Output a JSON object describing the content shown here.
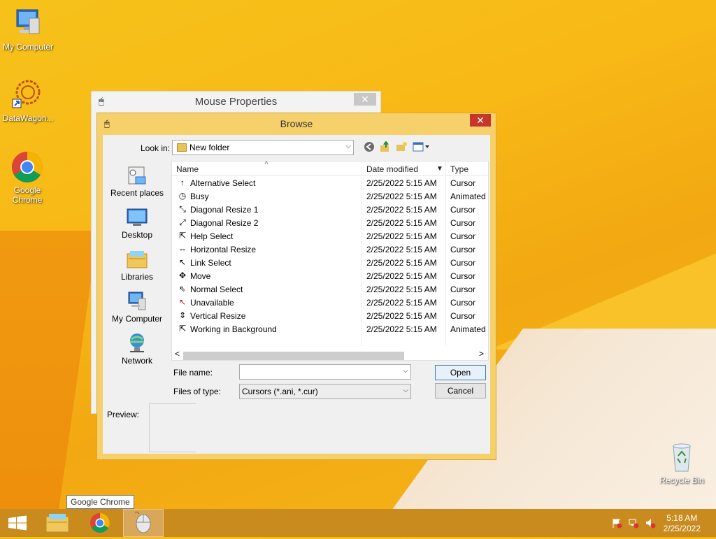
{
  "desktop": {
    "icons": [
      {
        "label": "My Computer"
      },
      {
        "label": "DataWagon..."
      },
      {
        "label": "Google Chrome"
      },
      {
        "label": "Recycle Bin"
      }
    ]
  },
  "mouse_properties": {
    "title": "Mouse Properties",
    "close": "✕"
  },
  "browse": {
    "title": "Browse",
    "close": "✕",
    "look_in_label": "Look in:",
    "look_in_value": "New folder",
    "places": [
      {
        "label": "Recent places"
      },
      {
        "label": "Desktop"
      },
      {
        "label": "Libraries"
      },
      {
        "label": "My Computer"
      },
      {
        "label": "Network"
      }
    ],
    "columns": {
      "name": "Name",
      "date": "Date modified",
      "type": "Type"
    },
    "files": [
      {
        "name": "Alternative Select",
        "date": "2/25/2022 5:15 AM",
        "type": "Cursor",
        "icon": "↑"
      },
      {
        "name": "Busy",
        "date": "2/25/2022 5:15 AM",
        "type": "Animated",
        "icon": "◷"
      },
      {
        "name": "Diagonal Resize 1",
        "date": "2/25/2022 5:15 AM",
        "type": "Cursor",
        "icon": "⤡"
      },
      {
        "name": "Diagonal Resize 2",
        "date": "2/25/2022 5:15 AM",
        "type": "Cursor",
        "icon": "⤢"
      },
      {
        "name": "Help Select",
        "date": "2/25/2022 5:15 AM",
        "type": "Cursor",
        "icon": "⇱"
      },
      {
        "name": "Horizontal Resize",
        "date": "2/25/2022 5:15 AM",
        "type": "Cursor",
        "icon": "⇔"
      },
      {
        "name": "Link Select",
        "date": "2/25/2022 5:15 AM",
        "type": "Cursor",
        "icon": "↖"
      },
      {
        "name": "Move",
        "date": "2/25/2022 5:15 AM",
        "type": "Cursor",
        "icon": "✥"
      },
      {
        "name": "Normal Select",
        "date": "2/25/2022 5:15 AM",
        "type": "Cursor",
        "icon": "⇖"
      },
      {
        "name": "Unavailable",
        "date": "2/25/2022 5:15 AM",
        "type": "Cursor",
        "icon": "↖"
      },
      {
        "name": "Vertical Resize",
        "date": "2/25/2022 5:15 AM",
        "type": "Cursor",
        "icon": "⇕"
      },
      {
        "name": "Working in Background",
        "date": "2/25/2022 5:15 AM",
        "type": "Animated",
        "icon": "⇱"
      }
    ],
    "file_name_label": "File name:",
    "file_name_value": "",
    "files_of_type_label": "Files of type:",
    "files_of_type_value": "Cursors (*.ani, *.cur)",
    "open_button": "Open",
    "cancel_button": "Cancel",
    "preview_label": "Preview:"
  },
  "tooltip": "Google Chrome",
  "taskbar": {
    "time": "5:18 AM",
    "date": "2/25/2022"
  },
  "colors": {
    "accent_close": "#c7362b",
    "dialog_frame": "#f6d06b",
    "unavailable_icon": "#b0271c"
  }
}
